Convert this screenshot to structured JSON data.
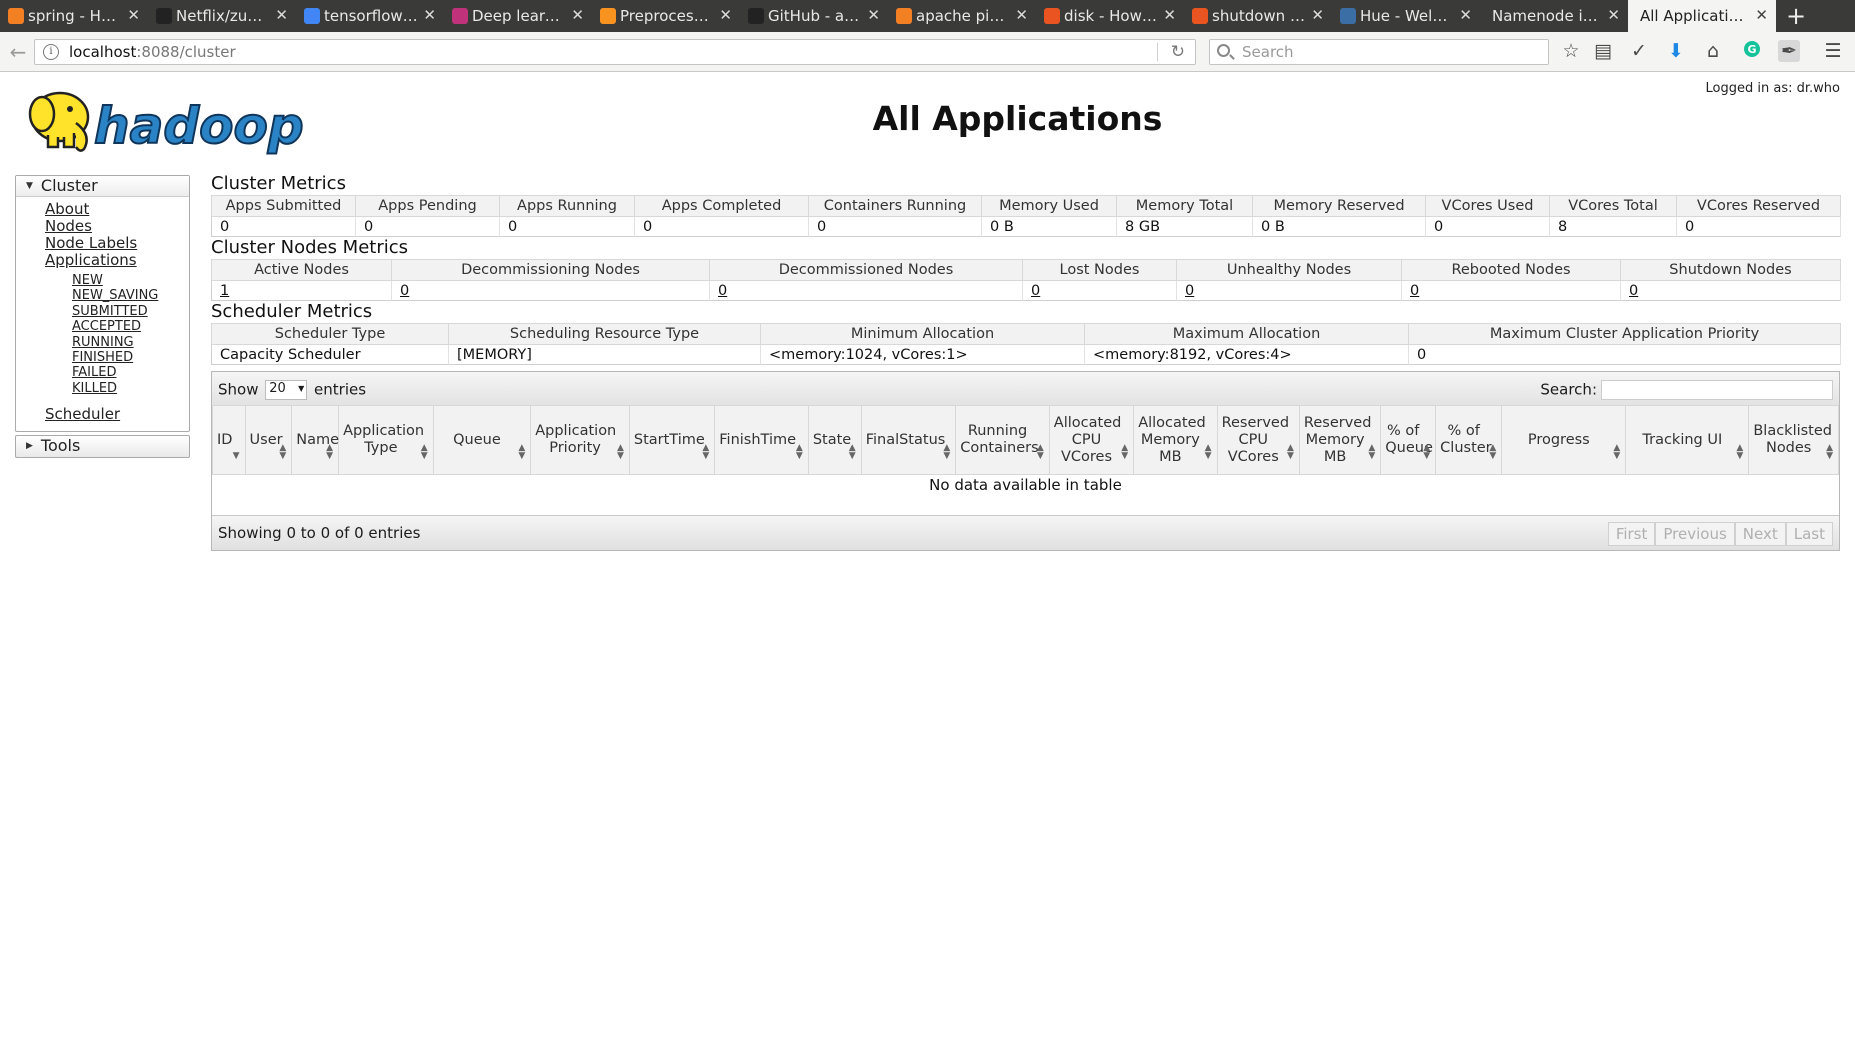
{
  "browser": {
    "tabs": [
      {
        "label": "spring - Ho…",
        "favicon_color": "#f48024",
        "active": false
      },
      {
        "label": "Netflix/zu…",
        "favicon_color": "#222222",
        "active": false
      },
      {
        "label": "tensorflow…",
        "favicon_color": "#4285f4",
        "active": false
      },
      {
        "label": "Deep learn…",
        "favicon_color": "#c0327a",
        "active": false
      },
      {
        "label": "Preprocess…",
        "favicon_color": "#f7931e",
        "active": false
      },
      {
        "label": "GitHub - a…",
        "favicon_color": "#222222",
        "active": false
      },
      {
        "label": "apache pig…",
        "favicon_color": "#f48024",
        "active": false
      },
      {
        "label": "disk - How …",
        "favicon_color": "#e95420",
        "active": false
      },
      {
        "label": "shutdown …",
        "favicon_color": "#e95420",
        "active": false
      },
      {
        "label": "Hue - Welc…",
        "favicon_color": "#3b6ea5",
        "active": false
      },
      {
        "label": "Namenode inf…",
        "favicon_color": "",
        "active": false
      },
      {
        "label": "All Applications",
        "favicon_color": "",
        "active": true
      }
    ],
    "url_host": "localhost",
    "url_path": ":8088/cluster",
    "search_placeholder": "Search"
  },
  "header": {
    "logo_text": "hadoop",
    "title": "All Applications",
    "logged_in": "Logged in as: dr.who"
  },
  "sidebar": {
    "cluster_label": "Cluster",
    "links": [
      "About",
      "Nodes",
      "Node Labels",
      "Applications"
    ],
    "app_states": [
      "NEW",
      "NEW_SAVING",
      "SUBMITTED",
      "ACCEPTED",
      "RUNNING",
      "FINISHED",
      "FAILED",
      "KILLED"
    ],
    "scheduler_label": "Scheduler",
    "tools_label": "Tools"
  },
  "cluster_metrics": {
    "title": "Cluster Metrics",
    "headers": [
      "Apps Submitted",
      "Apps Pending",
      "Apps Running",
      "Apps Completed",
      "Containers Running",
      "Memory Used",
      "Memory Total",
      "Memory Reserved",
      "VCores Used",
      "VCores Total",
      "VCores Reserved"
    ],
    "values": [
      "0",
      "0",
      "0",
      "0",
      "0",
      "0 B",
      "8 GB",
      "0 B",
      "0",
      "8",
      "0"
    ]
  },
  "nodes_metrics": {
    "title": "Cluster Nodes Metrics",
    "headers": [
      "Active Nodes",
      "Decommissioning Nodes",
      "Decommissioned Nodes",
      "Lost Nodes",
      "Unhealthy Nodes",
      "Rebooted Nodes",
      "Shutdown Nodes"
    ],
    "values": [
      "1",
      "0",
      "0",
      "0",
      "0",
      "0",
      "0"
    ]
  },
  "scheduler_metrics": {
    "title": "Scheduler Metrics",
    "headers": [
      "Scheduler Type",
      "Scheduling Resource Type",
      "Minimum Allocation",
      "Maximum Allocation",
      "Maximum Cluster Application Priority"
    ],
    "values": [
      "Capacity Scheduler",
      "[MEMORY]",
      "<memory:1024, vCores:1>",
      "<memory:8192, vCores:4>",
      "0"
    ]
  },
  "apps_table": {
    "show_label": "Show",
    "entries_value": "20",
    "entries_label": "entries",
    "search_label": "Search:",
    "columns": [
      "ID",
      "User",
      "Name",
      "Application Type",
      "Queue",
      "Application Priority",
      "StartTime",
      "FinishTime",
      "State",
      "FinalStatus",
      "Running Containers",
      "Allocated CPU VCores",
      "Allocated Memory MB",
      "Reserved CPU VCores",
      "Reserved Memory MB",
      "% of Queue",
      "% of Cluster",
      "Progress",
      "Tracking UI",
      "Blacklisted Nodes"
    ],
    "empty_text": "No data available in table",
    "info": "Showing 0 to 0 of 0 entries",
    "pager": [
      "First",
      "Previous",
      "Next",
      "Last"
    ]
  }
}
